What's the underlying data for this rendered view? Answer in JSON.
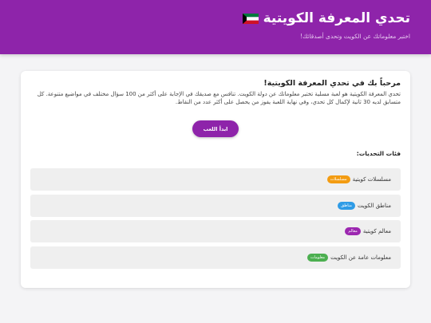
{
  "header": {
    "title": "تحدي المعرفة الكويتية",
    "flag_icon": "kuwait-flag-icon",
    "subtitle": "اختبر معلوماتك عن الكويت وتحدى أصدقائك!"
  },
  "welcome": {
    "title": "مرحباً بك في تحدي المعرفة الكويتية!",
    "text": "تحدي المعرفة الكويتية هو لعبة مسلية تختبر معلوماتك عن دولة الكويت. تنافس مع صديقك في الإجابة على أكثر من 100 سؤال مختلف في مواضيع متنوعة. كل متسابق لديه 30 ثانية لإكمال كل تحدي، وفي نهاية اللعبة يفوز من يحصل على أكثر عدد من النقاط."
  },
  "start_button": {
    "label": "ابدأ اللعب"
  },
  "categories": {
    "title": "فئات التحديات:",
    "items": [
      {
        "label": "مسلسلات كويتية",
        "badge": "مسلسلات",
        "color": "#f39c12"
      },
      {
        "label": "مناطق الكويت",
        "badge": "مناطق",
        "color": "#2e9be6"
      },
      {
        "label": "معالم كويتية",
        "badge": "معالم",
        "color": "#9c27b0"
      },
      {
        "label": "معلومات عامة عن الكويت",
        "badge": "معلومات",
        "color": "#4caf50"
      }
    ]
  },
  "colors": {
    "primary": "#8e24aa",
    "background": "#f4f4f6",
    "flag_green": "#007a3d",
    "flag_white": "#ffffff",
    "flag_red": "#ce1126",
    "flag_black": "#000000"
  }
}
